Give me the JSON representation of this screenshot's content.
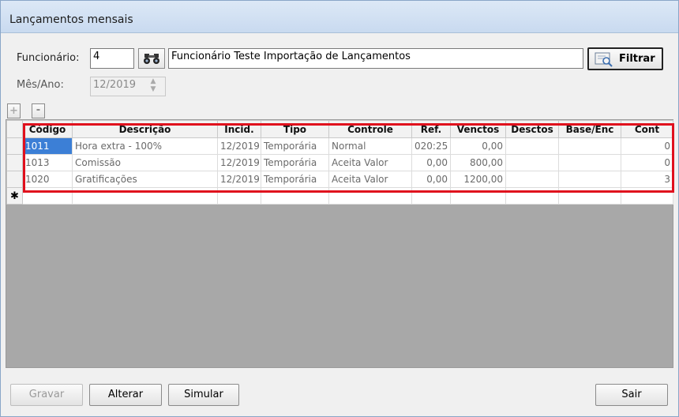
{
  "window": {
    "title": "Lançamentos mensais"
  },
  "form": {
    "funcionario_label": "Funcionário:",
    "funcionario_code": "4",
    "funcionario_name": "Funcionário Teste Importação de Lançamentos",
    "mesano_label": "Mês/Ano:",
    "mesano_value": "12/2019",
    "filter_label": "Filtrar"
  },
  "grid_toolbar": {
    "add": "+",
    "remove": "-"
  },
  "grid": {
    "columns": [
      "Código",
      "Descrição",
      "Incid.",
      "Tipo",
      "Controle",
      "Ref.",
      "Venctos",
      "Desctos",
      "Base/Enc",
      "Cont"
    ],
    "rows": [
      {
        "codigo": "1011",
        "descricao": "Hora extra - 100%",
        "incid": "12/2019",
        "tipo": "Temporária",
        "controle": "Normal",
        "ref": "020:25",
        "venctos": "0,00",
        "desctos": "",
        "base": "",
        "cont": "0"
      },
      {
        "codigo": "1013",
        "descricao": "Comissão",
        "incid": "12/2019",
        "tipo": "Temporária",
        "controle": "Aceita Valor",
        "ref": "0,00",
        "venctos": "800,00",
        "desctos": "",
        "base": "",
        "cont": "0"
      },
      {
        "codigo": "1020",
        "descricao": "Gratificações",
        "incid": "12/2019",
        "tipo": "Temporária",
        "controle": "Aceita Valor",
        "ref": "0,00",
        "venctos": "1200,00",
        "desctos": "",
        "base": "",
        "cont": "3"
      }
    ],
    "new_row_marker": "✱"
  },
  "buttons": {
    "gravar": "Gravar",
    "alterar": "Alterar",
    "simular": "Simular",
    "sair": "Sair"
  },
  "colors": {
    "selection": "#3c7fd6",
    "highlight_box": "#e0101d"
  },
  "icons": {
    "search": "binoculars-icon",
    "filter": "filter-icon",
    "add": "plus-icon",
    "remove": "minus-icon"
  }
}
